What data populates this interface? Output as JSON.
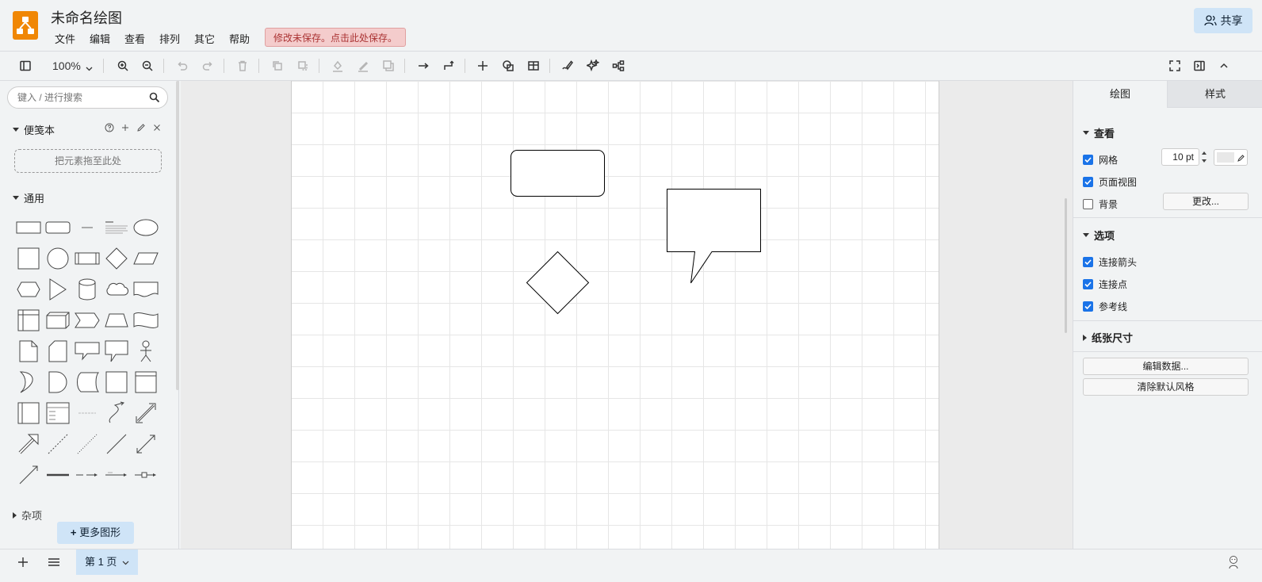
{
  "header": {
    "title": "未命名绘图",
    "menu": [
      "文件",
      "编辑",
      "查看",
      "排列",
      "其它",
      "帮助"
    ],
    "unsaved_notice": "修改未保存。点击此处保存。",
    "share_label": "共享"
  },
  "toolbar": {
    "zoom": "100%",
    "icons": [
      "format-panel-icon",
      "zoom-in-icon",
      "zoom-out-icon",
      "undo-icon",
      "redo-icon",
      "delete-icon",
      "to-front-icon",
      "to-back-icon",
      "fill-color-icon",
      "line-color-icon",
      "shadow-icon",
      "connection-icon",
      "waypoint-icon",
      "insert-icon",
      "shapes-icon",
      "table-icon",
      "freehand-icon",
      "magic-icon",
      "layout-icon",
      "fullscreen-icon",
      "collapse-panel-icon",
      "collapse-up-icon"
    ]
  },
  "left": {
    "search_placeholder": "键入 / 进行搜索",
    "scratchpad_title": "便笺本",
    "dropzone_text": "把元素拖至此处",
    "general_title": "通用",
    "next_section_title": "杂项",
    "more_shapes": "更多图形"
  },
  "right": {
    "tab_diagram": "绘图",
    "tab_style": "样式",
    "view_title": "查看",
    "grid_label": "网格",
    "grid_size": "10 pt",
    "page_view_label": "页面视图",
    "background_label": "背景",
    "change_button": "更改...",
    "options_title": "选项",
    "connection_arrows_label": "连接箭头",
    "connection_points_label": "连接点",
    "guides_label": "参考线",
    "paper_size_title": "纸张尺寸",
    "edit_data_button": "编辑数据...",
    "clear_style_button": "清除默认风格",
    "checks": {
      "grid": true,
      "page_view": true,
      "background": false,
      "connection_arrows": true,
      "connection_points": true,
      "guides": true
    }
  },
  "bottom": {
    "page_tab": "第 1 页"
  },
  "colors": {
    "accent_blue": "#cfe4f7",
    "checkbox_blue": "#1a73e8",
    "logo_orange": "#f08705",
    "unsaved_bg": "#f4cccc"
  }
}
